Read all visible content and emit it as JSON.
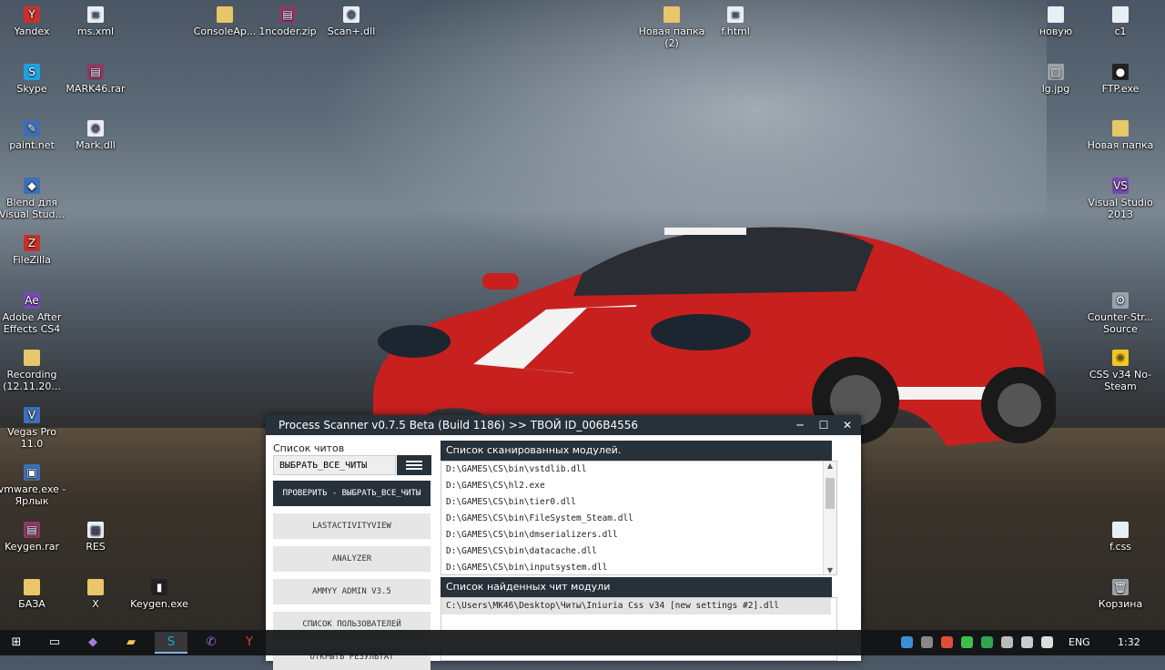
{
  "desktop": {
    "icons_left": [
      {
        "label": "Yandex",
        "glyph": "Y",
        "kind": "g-red"
      },
      {
        "label": "ms.xml",
        "glyph": "≡",
        "kind": "g-file"
      },
      {
        "label": "Skype",
        "glyph": "S",
        "kind": "g-sky"
      },
      {
        "label": "MARK46.rar",
        "glyph": "▤",
        "kind": "g-rar"
      },
      {
        "label": "paint.net",
        "glyph": "✎",
        "kind": "g-exe"
      },
      {
        "label": "Mark.dll",
        "glyph": "⚙",
        "kind": "g-file"
      },
      {
        "label": "Blend для Visual Stud...",
        "glyph": "◆",
        "kind": "g-exe"
      },
      {
        "label": "FileZilla",
        "glyph": "Z",
        "kind": "g-red"
      },
      {
        "label": "Adobe After Effects CS4",
        "glyph": "Ae",
        "kind": "g-purple"
      },
      {
        "label": "Recording (12.11.20...",
        "glyph": "",
        "kind": "g-folder"
      },
      {
        "label": "Vegas Pro 11.0",
        "glyph": "V",
        "kind": "g-exe"
      },
      {
        "label": "vmware.exe - Ярлык",
        "glyph": "▣",
        "kind": "g-exe"
      },
      {
        "label": "Keygen.rar",
        "glyph": "▤",
        "kind": "g-rar"
      },
      {
        "label": "RES",
        "glyph": "▦",
        "kind": "g-file"
      },
      {
        "label": "БАЗА",
        "glyph": "",
        "kind": "g-folder"
      },
      {
        "label": "X",
        "glyph": "",
        "kind": "g-folder"
      },
      {
        "label": "Keygen.exe",
        "glyph": "▮",
        "kind": "g-dark"
      }
    ],
    "icons_top": [
      {
        "label": "ConsoleAp...",
        "glyph": "",
        "kind": "g-folder"
      },
      {
        "label": "1ncoder.zip",
        "glyph": "▤",
        "kind": "g-rar"
      },
      {
        "label": "Scan+.dll",
        "glyph": "⚙",
        "kind": "g-file"
      },
      {
        "label": "Новая папка (2)",
        "glyph": "",
        "kind": "g-folder"
      },
      {
        "label": "f.html",
        "glyph": "≡",
        "kind": "g-file"
      }
    ],
    "icons_right": [
      {
        "label": "новую",
        "glyph": "",
        "kind": "g-file"
      },
      {
        "label": "c1",
        "glyph": "",
        "kind": "g-file"
      },
      {
        "label": "lg.jpg",
        "glyph": "▨",
        "kind": "g-gray"
      },
      {
        "label": "FTP.exe",
        "glyph": "●",
        "kind": "g-dark"
      },
      {
        "label": "Новая папка",
        "glyph": "",
        "kind": "g-folder"
      },
      {
        "label": "Visual Studio 2013",
        "glyph": "VS",
        "kind": "g-purple"
      },
      {
        "label": "Counter-Str... Source",
        "glyph": "⚙",
        "kind": "g-gray"
      },
      {
        "label": "CSS v34 No-Steam",
        "glyph": "☼",
        "kind": "g-yellow"
      },
      {
        "label": "f.css",
        "glyph": "",
        "kind": "g-file"
      },
      {
        "label": "Корзина",
        "glyph": "🗑",
        "kind": "g-gray"
      }
    ]
  },
  "window": {
    "title": "Process Scanner v0.7.5 Beta (Build 1186)  >> ТВОЙ ID_006B4556",
    "minimize": "✕",
    "cheats_label": "Список  читов",
    "select_value": "ВЫБРАТЬ_ВСЕ_ЧИТЫ",
    "buttons": {
      "check": "ПРОВЕРИТЬ - ВЫБРАТЬ_ВСЕ_ЧИТЫ",
      "lastactivity": "LASTACTIVITYVIEW",
      "analyzer": "ANALYZER",
      "ammyy": "AMMYY ADMIN V3.5",
      "users": "СПИСОК ПОЛЬЗОВАТЕЛЕЙ",
      "open_result": "ОТКРЫТЬ РЕЗУЛЬТАТ"
    },
    "scanned_header": "Список сканированных модулей.",
    "scanned_modules": [
      "D:\\GAMES\\CS\\bin\\vstdlib.dll",
      "D:\\GAMES\\CS\\hl2.exe",
      "D:\\GAMES\\CS\\bin\\tier0.dll",
      "D:\\GAMES\\CS\\bin\\FileSystem_Steam.dll",
      "D:\\GAMES\\CS\\bin\\dmserializers.dll",
      "D:\\GAMES\\CS\\bin\\datacache.dll",
      "D:\\GAMES\\CS\\bin\\inputsystem.dll"
    ],
    "found_header": "Список найденных чит модули",
    "found_modules": [
      "C:\\Users\\MK46\\Desktop\\Читы\\Iniuria Css v34 [new settings #2].dll"
    ]
  },
  "taskbar": {
    "language": "ENG",
    "clock": "1:32"
  },
  "colors": {
    "window_dark": "#27313a",
    "accent": "#7fb3ff"
  }
}
